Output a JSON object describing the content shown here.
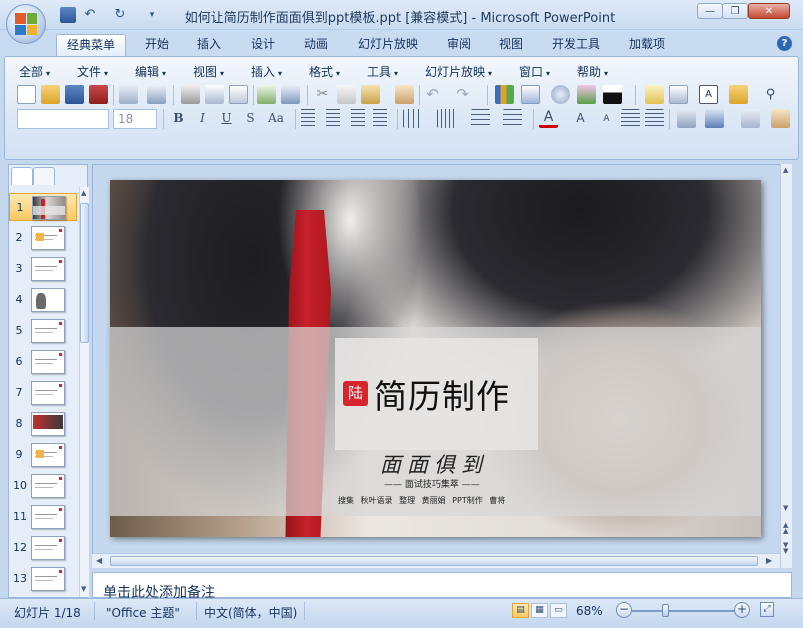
{
  "window": {
    "title": "如何让简历制作面面俱到ppt模板.ppt [兼容模式] - Microsoft PowerPoint",
    "controls": {
      "minimize": "—",
      "restore": "❐",
      "close": "✕"
    }
  },
  "quick_access": [
    "save-icon",
    "undo-icon",
    "redo-icon",
    "customize-icon"
  ],
  "tabs": [
    {
      "label": "经典菜单",
      "active": true
    },
    {
      "label": "开始"
    },
    {
      "label": "插入"
    },
    {
      "label": "设计"
    },
    {
      "label": "动画"
    },
    {
      "label": "幻灯片放映"
    },
    {
      "label": "审阅"
    },
    {
      "label": "视图"
    },
    {
      "label": "开发工具"
    },
    {
      "label": "加载项"
    }
  ],
  "help_icon": "?",
  "menu": [
    "全部",
    "文件",
    "编辑",
    "视图",
    "插入",
    "格式",
    "工具",
    "幻灯片放映",
    "窗口",
    "帮助"
  ],
  "font": {
    "name": "",
    "size": "18"
  },
  "format_buttons": [
    "B",
    "I",
    "U",
    "S",
    "Aa"
  ],
  "slides": [
    {
      "num": "1",
      "selected": true
    },
    {
      "num": "2"
    },
    {
      "num": "3"
    },
    {
      "num": "4"
    },
    {
      "num": "5"
    },
    {
      "num": "6"
    },
    {
      "num": "7"
    },
    {
      "num": "8"
    },
    {
      "num": "9"
    },
    {
      "num": "10"
    },
    {
      "num": "11"
    },
    {
      "num": "12"
    },
    {
      "num": "13"
    }
  ],
  "slide": {
    "badge": "陆",
    "title": "简历制作",
    "calligraphy": "面面俱到",
    "subtitle": "—— 面试技巧集萃 ——",
    "credits": "搜集 秋叶语录 整理 黄丽娟 PPT制作 曹将"
  },
  "notes_placeholder": "单击此处添加备注",
  "status": {
    "slide_info": "幻灯片 1/18",
    "theme": "\"Office 主题\"",
    "language": "中文(简体，中国)",
    "zoom": "68%",
    "zoom_level": 0.3
  },
  "colors": {
    "accent_red": "#d8242c",
    "ribbon_blue": "#c9dbf1",
    "selection": "#f9c95f"
  }
}
